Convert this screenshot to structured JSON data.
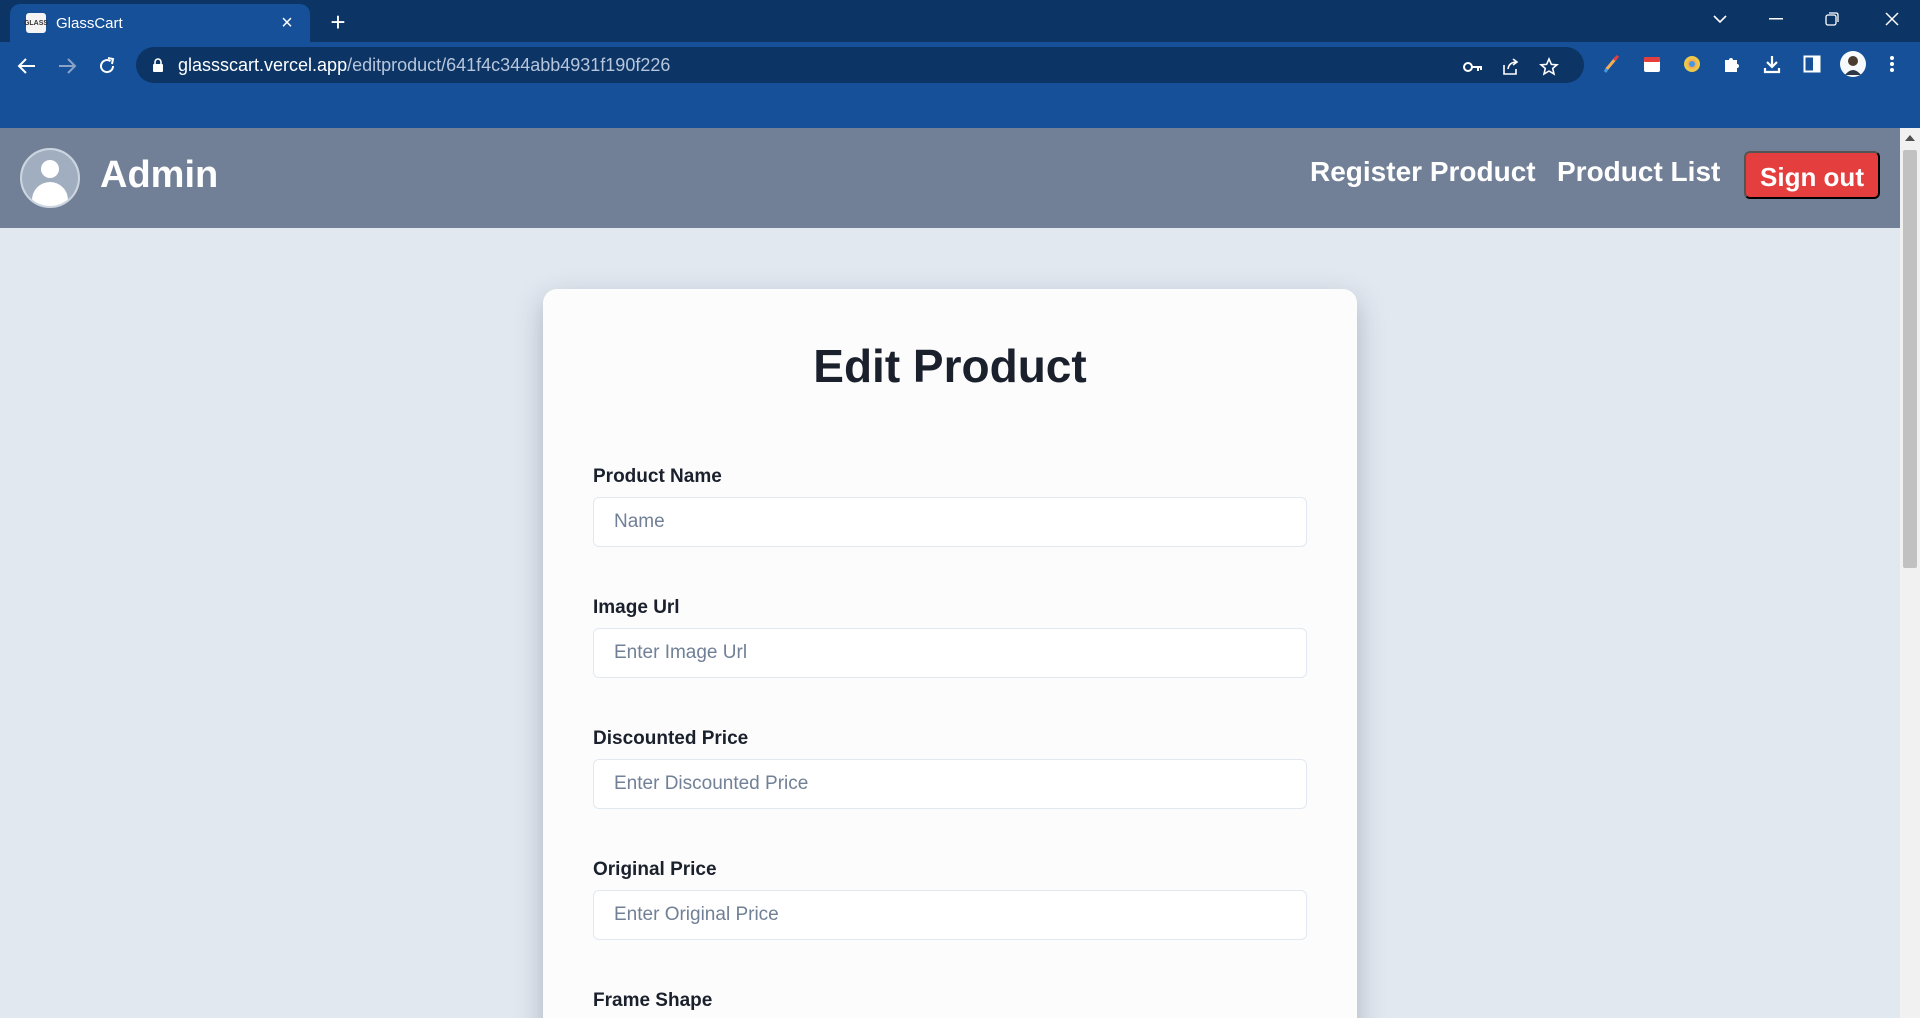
{
  "browser": {
    "tab_title": "GlassCart",
    "favicon_text": "GLASS",
    "url_host": "glassscart.vercel.app",
    "url_path": "/editproduct/641f4c344abb4931f190f226"
  },
  "header": {
    "title": "Admin",
    "nav": {
      "register": "Register Product",
      "list": "Product List"
    },
    "signout_label": "Sign out",
    "bg_color": "#718096",
    "signout_color": "#e53e3e"
  },
  "form": {
    "title": "Edit Product",
    "fields": [
      {
        "label": "Product Name",
        "placeholder": "Name"
      },
      {
        "label": "Image Url",
        "placeholder": "Enter Image Url"
      },
      {
        "label": "Discounted Price",
        "placeholder": "Enter Discounted Price"
      },
      {
        "label": "Original Price",
        "placeholder": "Enter Original Price"
      },
      {
        "label": "Frame Shape"
      }
    ]
  },
  "icons": {
    "tab_close": "close-icon",
    "new_tab": "plus-icon",
    "back": "arrow-left-icon",
    "forward": "arrow-right-icon",
    "reload": "reload-icon",
    "lock": "lock-icon",
    "key": "key-icon",
    "share": "share-icon",
    "star": "star-icon",
    "extensions": "puzzle-icon",
    "download": "download-icon",
    "sidepanel": "side-panel-icon",
    "menu": "kebab-menu-icon",
    "avatar": "user-avatar-icon"
  }
}
